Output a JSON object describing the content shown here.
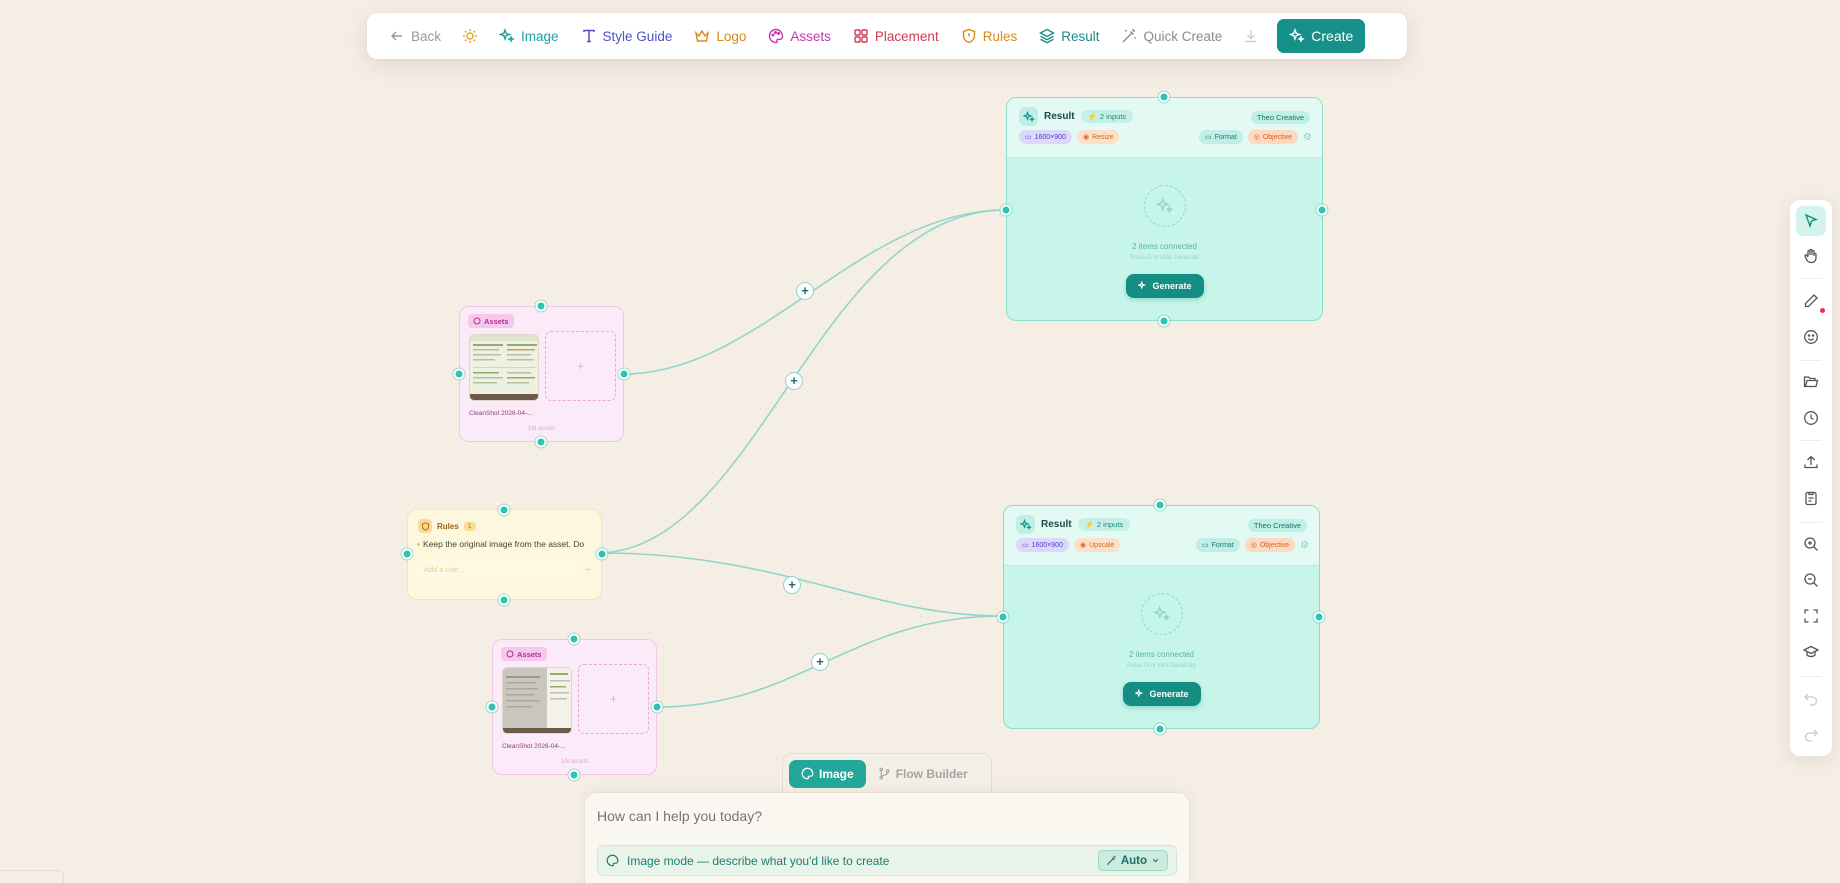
{
  "toolbar": {
    "back": "Back",
    "image": "Image",
    "style_guide": "Style Guide",
    "logo": "Logo",
    "assets": "Assets",
    "placement": "Placement",
    "rules": "Rules",
    "result": "Result",
    "quick_create": "Quick Create",
    "create": "Create"
  },
  "asset_nodes": [
    {
      "badge": "Assets",
      "caption": "CleanShot 2026-04-...",
      "count": "1/8 assets"
    },
    {
      "badge": "Assets",
      "caption": "CleanShot 2026-04-...",
      "count": "1/8 assets"
    }
  ],
  "rules_node": {
    "title": "Rules",
    "count": "1",
    "rule": "Keep the original image from the asset. Do",
    "placeholder": "Add a rule..."
  },
  "result_nodes": [
    {
      "title": "Result",
      "inputs": "2 inputs",
      "creative": "Theo Creative",
      "size": "1600×900",
      "mode": "Resize",
      "format": "Format",
      "objective": "Objective",
      "connected": "2 items connected",
      "hint": "Press G or click Generate",
      "generate": "Generate"
    },
    {
      "title": "Result",
      "inputs": "2 inputs",
      "creative": "Theo Creative",
      "size": "1600×900",
      "mode": "Upscale",
      "format": "Format",
      "objective": "Objective",
      "connected": "2 items connected",
      "hint": "Press G or click Generate",
      "generate": "Generate"
    }
  ],
  "composer": {
    "tab_image": "Image",
    "tab_flow": "Flow Builder",
    "placeholder": "How can I help you today?",
    "mode_text": "Image mode — describe what you'd like to create",
    "auto": "Auto"
  },
  "icons": {
    "back": "arrow-left-icon",
    "theme": "sun-icon",
    "image": "sparkles-icon",
    "style_guide": "type-icon",
    "logo": "crown-icon",
    "assets": "palette-icon",
    "placement": "layout-grid-icon",
    "rules": "shield-icon",
    "result": "layers-icon",
    "quick_create": "wand-icon",
    "download": "download-icon",
    "create": "sparkles-icon"
  },
  "colors": {
    "canvas": "#f5eee4",
    "accent": "#15918a",
    "edge": "#8fd6c9",
    "port": "#2fc4b2",
    "asset_node": "#fbeaf7",
    "rules_node": "#fdf7dd",
    "result_node": "#c7f5ea"
  }
}
